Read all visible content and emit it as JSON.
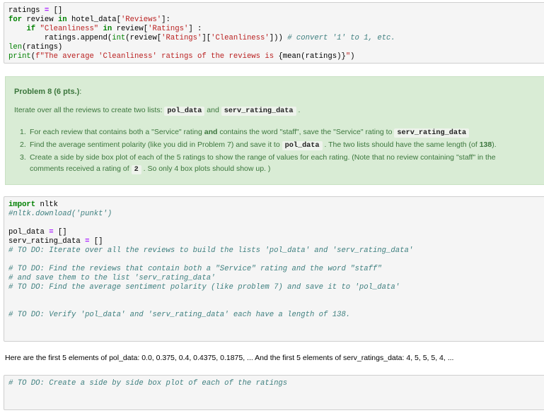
{
  "cells": {
    "cell1": {
      "lines": [
        [
          {
            "t": "ratings ",
            "c": ""
          },
          {
            "t": "=",
            "c": "op"
          },
          {
            "t": " []",
            "c": ""
          }
        ],
        [
          {
            "t": "for",
            "c": "kw"
          },
          {
            "t": " review ",
            "c": ""
          },
          {
            "t": "in",
            "c": "kw"
          },
          {
            "t": " hotel_data[",
            "c": ""
          },
          {
            "t": "'Reviews'",
            "c": "str"
          },
          {
            "t": "]:",
            "c": ""
          }
        ],
        [
          {
            "t": "    ",
            "c": ""
          },
          {
            "t": "if",
            "c": "kw"
          },
          {
            "t": " ",
            "c": ""
          },
          {
            "t": "\"Cleanliness\"",
            "c": "str"
          },
          {
            "t": " ",
            "c": ""
          },
          {
            "t": "in",
            "c": "kw"
          },
          {
            "t": " review[",
            "c": ""
          },
          {
            "t": "'Ratings'",
            "c": "str"
          },
          {
            "t": "] :",
            "c": ""
          }
        ],
        [
          {
            "t": "        ratings.append(",
            "c": ""
          },
          {
            "t": "int",
            "c": "bi"
          },
          {
            "t": "(review[",
            "c": ""
          },
          {
            "t": "'Ratings'",
            "c": "str"
          },
          {
            "t": "][",
            "c": ""
          },
          {
            "t": "'Cleanliness'",
            "c": "str"
          },
          {
            "t": "])) ",
            "c": ""
          },
          {
            "t": "# convert '1' to 1, etc.",
            "c": "cm"
          }
        ],
        [
          {
            "t": "len",
            "c": "bi"
          },
          {
            "t": "(ratings)",
            "c": ""
          }
        ],
        [
          {
            "t": "print",
            "c": "bi"
          },
          {
            "t": "(",
            "c": ""
          },
          {
            "t": "f\"The average 'Cleanliness' ratings of the reviews is ",
            "c": "str"
          },
          {
            "t": "{mean(ratings)}",
            "c": ""
          },
          {
            "t": "\"",
            "c": "str"
          },
          {
            "t": ")",
            "c": ""
          }
        ]
      ]
    },
    "cell2": {
      "lines": [
        [
          {
            "t": "import",
            "c": "kw"
          },
          {
            "t": " nltk",
            "c": ""
          }
        ],
        [
          {
            "t": "#nltk.download('punkt')",
            "c": "cm"
          }
        ],
        [],
        [
          {
            "t": "pol_data ",
            "c": ""
          },
          {
            "t": "=",
            "c": "op"
          },
          {
            "t": " []",
            "c": ""
          }
        ],
        [
          {
            "t": "serv_rating_data ",
            "c": ""
          },
          {
            "t": "=",
            "c": "op"
          },
          {
            "t": " []",
            "c": ""
          }
        ],
        [
          {
            "t": "# TO DO: Iterate over all the reviews to build the lists 'pol_data' and 'serv_rating_data'",
            "c": "cm"
          }
        ],
        [],
        [
          {
            "t": "# TO DO: Find the reviews that contain both a \"Service\" rating and the word \"staff\"",
            "c": "cm"
          }
        ],
        [
          {
            "t": "# and save them to the list 'serv_rating_data'",
            "c": "cm"
          }
        ],
        [
          {
            "t": "# TO DO: Find the average sentiment polarity (like problem 7) and save it to 'pol_data'",
            "c": "cm"
          }
        ],
        [],
        [],
        [
          {
            "t": "# TO DO: Verify 'pol_data' and 'serv_rating_data' each have a length of 138.",
            "c": "cm"
          }
        ]
      ]
    },
    "cell3": {
      "lines": [
        [
          {
            "t": "# TO DO: Create a side by side box plot of each of the ratings",
            "c": "cm"
          }
        ]
      ]
    }
  },
  "markdown": {
    "title_bold": "Problem 8 (6 pts.)",
    "title_tail": ":",
    "intro_prefix": "Iterate over all the reviews to create two lists: ",
    "intro_code1": "pol_data",
    "intro_mid": " and ",
    "intro_code2": "serv_rating_data",
    "intro_suffix": " .",
    "items": [
      {
        "num": "1.",
        "p1": "For each review that contains both a \"Service\" rating ",
        "bold": "and",
        "p2": " contains the word \"staff\", save the \"Service\" rating to ",
        "code": "serv_rating_data"
      },
      {
        "num": "2.",
        "p1": "Find the average sentiment polarity (like you did in Problem 7) and save it to ",
        "code": "pol_data",
        "p2": " . The two lists should have the same length (of ",
        "bold": "138",
        "p3": ")."
      },
      {
        "num": "3.",
        "p1": "Create a side by side box plot of each of the 5 ratings to show the range of values for each rating. (Note that no review containing \"staff\" in the",
        "p2": "comments received a rating of ",
        "code": "2",
        "p3": " . So only 4 box plots should show up. )"
      }
    ]
  },
  "info_text": "Here are the first 5 elements of pol_data: 0.0, 0.375, 0.4, 0.4375, 0.1875, ... And the first 5 elements of serv_ratings_data: 4, 5, 5, 5, 4, ..."
}
